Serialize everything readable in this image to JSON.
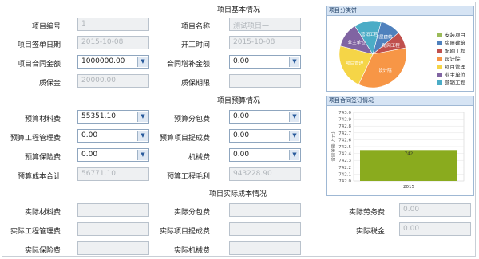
{
  "basic": {
    "title": "项目基本情况",
    "project_no_label": "项目编号",
    "project_no": "1",
    "project_name_label": "项目名称",
    "project_name": "测试项目一",
    "sign_date_label": "项目签单日期",
    "sign_date": "2015-10-08",
    "start_date_label": "开工时间",
    "start_date": "2015-10-08",
    "contract_amount_label": "项目合同金额",
    "contract_amount": "1000000.00",
    "contract_supp_label": "合同增补金额",
    "contract_supp": "0.00",
    "deposit_label": "质保金",
    "deposit": "20000.00",
    "warranty_label": "质保期限",
    "warranty": ""
  },
  "budget": {
    "title": "项目预算情况",
    "material_label": "预算材料费",
    "material": "55351.10",
    "subcontract_label": "预算分包费",
    "subcontract": "0.00",
    "mgmt_label": "预算工程管理费",
    "mgmt": "0.00",
    "commission_label": "预算项目提成费",
    "commission": "0.00",
    "warranty_fee_label": "预算保险费",
    "warranty_fee": "0.00",
    "machine_label": "机械费",
    "machine": "0.00",
    "cost_total_label": "预算成本合计",
    "cost_total": "56771.10",
    "gross_profit_label": "预算工程毛利",
    "gross_profit": "943228.90"
  },
  "actual": {
    "title": "项目实际成本情况",
    "material_label": "实际材料费",
    "material": "",
    "subcontract_label": "实际分包费",
    "subcontract": "",
    "labor_label": "实际劳务费",
    "labor": "0.00",
    "mgmt_label": "实际工程管理费",
    "mgmt": "",
    "commission_label": "实际项目提成费",
    "commission": "",
    "tax_label": "实际税金",
    "tax": "0.00",
    "warranty_fee_label": "实际保险费",
    "warranty_fee": "",
    "machine_label": "实际机械费",
    "machine": ""
  },
  "panels": {
    "category_title": "项目分类饼",
    "contract_title": "项目合同签订情况"
  },
  "chart_data": [
    {
      "type": "pie",
      "title": "项目分类饼",
      "slices": [
        {
          "name": "安装项目",
          "value": 0,
          "color": "#9bbb59"
        },
        {
          "name": "房屋建筑",
          "value": 10,
          "color": "#4f81bd"
        },
        {
          "name": "配网工程",
          "value": 8,
          "color": "#c0504d"
        },
        {
          "name": "设计院",
          "value": 35,
          "color": "#f79646"
        },
        {
          "name": "项目管理",
          "value": 22,
          "color": "#f5d547"
        },
        {
          "name": "业主单位",
          "value": 12,
          "color": "#8064a2"
        },
        {
          "name": "营销工程",
          "value": 13,
          "color": "#4bacc6"
        }
      ],
      "slice_labels": [
        "房屋建筑",
        "配网工程",
        "设计院",
        "项目管理",
        "业主单位",
        "营销工程"
      ],
      "legend_position": "right"
    },
    {
      "type": "bar",
      "title": "项目合同签订情况",
      "categories": [
        "2015"
      ],
      "values": [
        742
      ],
      "ylabel": "合同金额(万元)",
      "yticks": [
        "743.0",
        "742.9",
        "742.8",
        "742.7",
        "742.6",
        "742.5",
        "742.4",
        "742.3",
        "742.2",
        "742.1",
        "742.0"
      ],
      "bar_label": "742",
      "bar_color": "#8aab1e"
    }
  ]
}
